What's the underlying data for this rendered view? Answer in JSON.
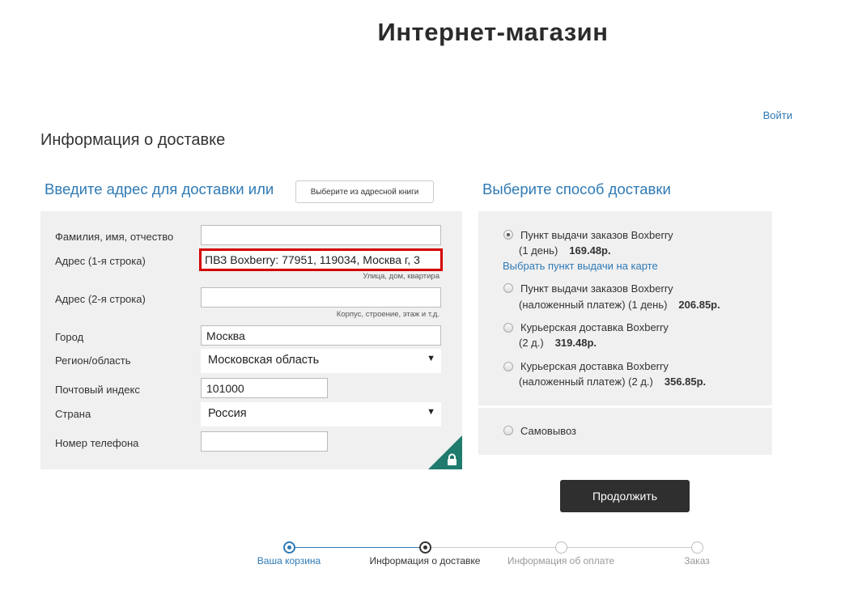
{
  "header": {
    "title": "Интернет-магазин",
    "login_label": "Войти"
  },
  "section_title": "Информация о доставке",
  "address": {
    "heading": "Введите адрес для доставки или",
    "address_book_button": "Выберите из адресной книги",
    "fields": {
      "full_name": {
        "label": "Фамилия, имя, отчество",
        "value": ""
      },
      "address1": {
        "label": "Адрес (1-я строка)",
        "value": "ПВЗ Boxberry: 77951, 119034, Москва г, 3",
        "hint": "Улица, дом, квартира"
      },
      "address2": {
        "label": "Адрес (2-я строка)",
        "value": "",
        "hint": "Корпус, строение, этаж и т.д."
      },
      "city": {
        "label": "Город",
        "value": "Москва"
      },
      "region": {
        "label": "Регион/область",
        "value": "Московская область"
      },
      "postal": {
        "label": "Почтовый индекс",
        "value": "101000"
      },
      "country": {
        "label": "Страна",
        "value": "Россия"
      },
      "phone": {
        "label": "Номер телефона",
        "value": ""
      }
    },
    "lock_icon": "lock-icon"
  },
  "shipping": {
    "heading": "Выберите способ доставки",
    "options": [
      {
        "line1": "Пункт выдачи заказов Boxberry",
        "line2": "(1 день)",
        "price": "169.48р.",
        "checked": true,
        "map_link": "Выбрать пункт выдачи на карте"
      },
      {
        "line1": "Пункт выдачи заказов Boxberry",
        "line2": "(наложенный платеж) (1 день)",
        "price": "206.85р.",
        "checked": false
      },
      {
        "line1": "Курьерская доставка Boxberry",
        "line2": "(2 д.)",
        "price": "319.48р.",
        "checked": false
      },
      {
        "line1": "Курьерская доставка Boxberry",
        "line2": "(наложенный платеж) (2 д.)",
        "price": "356.85р.",
        "checked": false
      }
    ],
    "pickup": {
      "label": "Самовывоз",
      "checked": false
    }
  },
  "continue_label": "Продолжить",
  "steps": [
    {
      "label": "Ваша корзина",
      "state": "done"
    },
    {
      "label": "Информация о доставке",
      "state": "current"
    },
    {
      "label": "Информация об оплате",
      "state": "todo"
    },
    {
      "label": "Заказ",
      "state": "todo"
    }
  ],
  "colors": {
    "accent": "#2f7ab5",
    "error_border": "#d40000",
    "lock_corner": "#1f7b6d",
    "button": "#2f2f2f"
  }
}
